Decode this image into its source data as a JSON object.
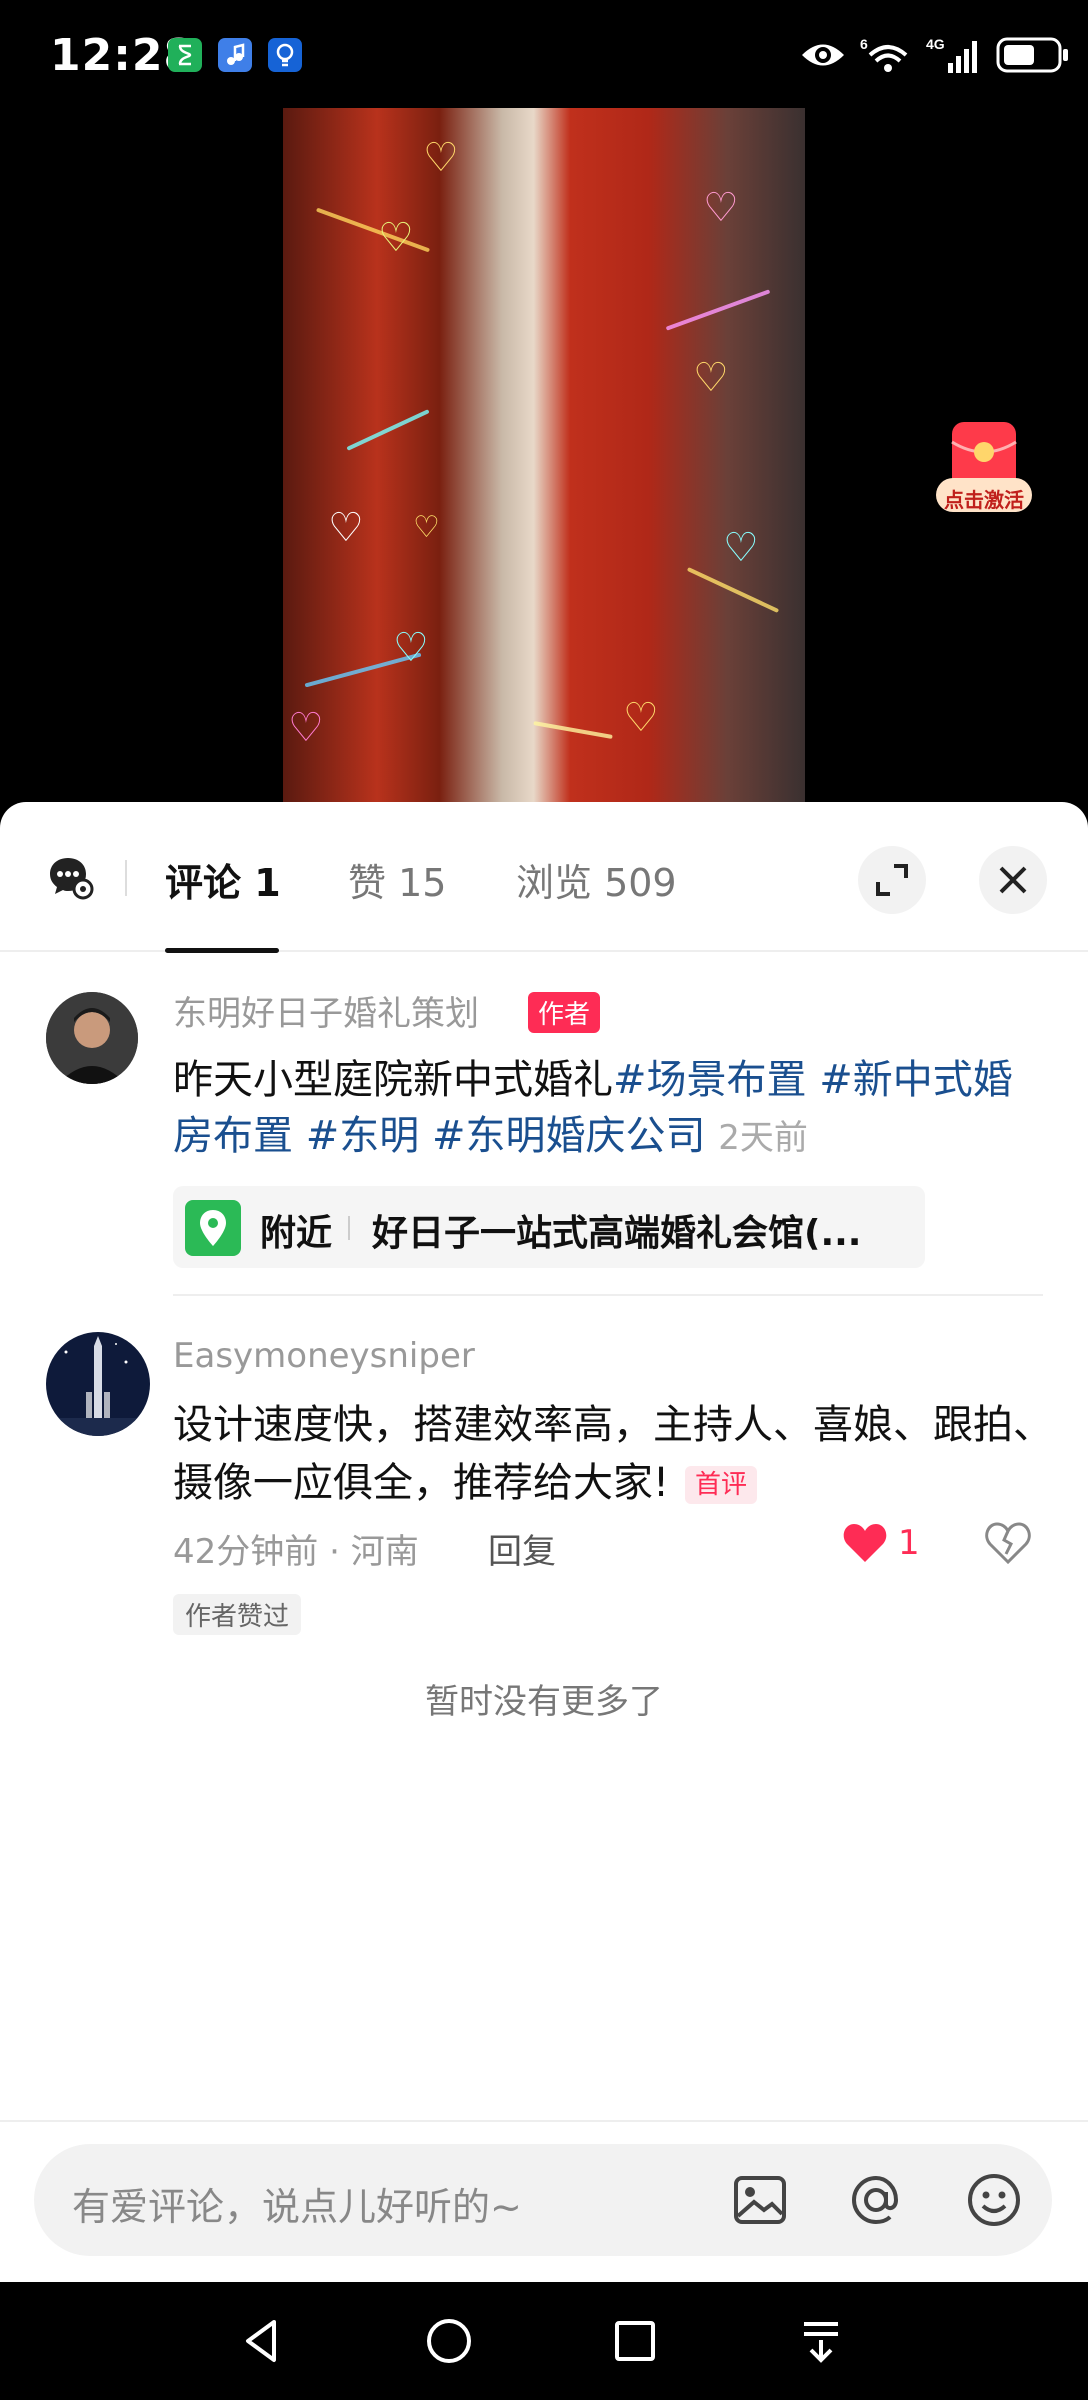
{
  "status_bar": {
    "time": "12:28",
    "network": "4G",
    "sim_label": "6"
  },
  "video": {
    "redpack_label": "点击激活"
  },
  "sheet": {
    "tabs": [
      {
        "label": "评论 1"
      },
      {
        "label": "赞 15"
      },
      {
        "label": "浏览 509"
      }
    ],
    "post": {
      "author": "东明好日子婚礼策划",
      "author_badge": "作者",
      "text": "昨天小型庭院新中式婚礼",
      "hashtags": [
        "#场景布置",
        "#新中式婚房布置",
        "#东明",
        "#东明婚庆公司"
      ],
      "time": "2天前",
      "location_near": "附近",
      "location_name": "好日子一站式高端婚礼会馆(..."
    },
    "comment": {
      "user": "Easymoneysniper",
      "text": "设计速度快，搭建效率高，主持人、喜娘、跟拍、摄像一应俱全，推荐给大家!",
      "first_badge": "首评",
      "time": "42分钟前",
      "location": "河南",
      "reply_label": "回复",
      "likes": "1",
      "author_liked": "作者赞过"
    },
    "no_more": "暂时没有更多了"
  },
  "input": {
    "placeholder": "有爱评论，说点儿好听的~"
  },
  "colors": {
    "accent": "#fe2c55",
    "hashtag": "#1a4f8f",
    "location_green": "#2bba56"
  }
}
